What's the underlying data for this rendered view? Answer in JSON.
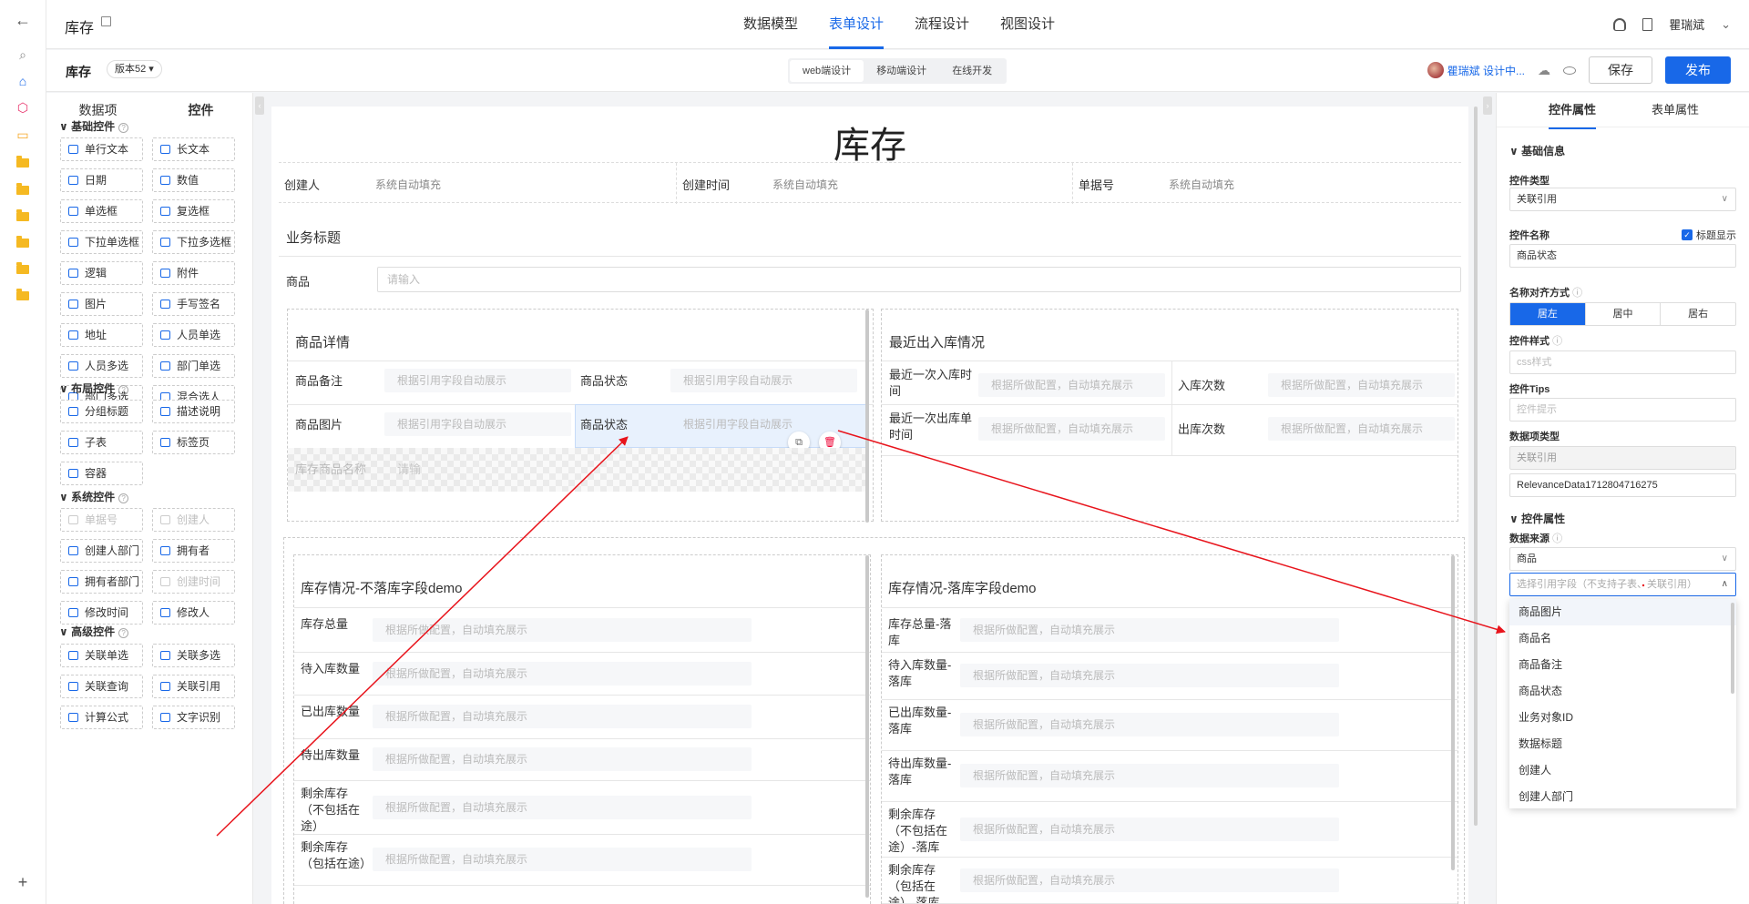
{
  "rail": {
    "icons": [
      "back-arrow-icon",
      "search-icon",
      "home-icon",
      "cube-icon",
      "message-icon",
      "folder-icon",
      "folder-icon",
      "folder-icon",
      "folder-icon",
      "folder-icon",
      "folder-icon",
      "plus-icon"
    ],
    "glyphs": {
      "back": "←",
      "search": "⌕",
      "home": "⌂",
      "cube": "⬡",
      "message": "▭",
      "plus": "+"
    },
    "accent_colors": {
      "home": "#1868e8",
      "cube": "#e8356d",
      "message": "#f5a623"
    }
  },
  "header": {
    "title": "库存",
    "nav": [
      "数据模型",
      "表单设计",
      "流程设计",
      "视图设计"
    ],
    "active_nav": "表单设计",
    "user": "瞿瑞斌",
    "user_suffix": "⌄"
  },
  "subbar": {
    "name": "库存",
    "version": "版本52 ▾",
    "segments": [
      "web端设计",
      "移动端设计",
      "在线开发"
    ],
    "active_segment": "web端设计",
    "designer": "瞿瑞斌 设计中...",
    "save": "保存",
    "publish": "发布"
  },
  "left_panel": {
    "tabs": [
      "数据项",
      "控件"
    ],
    "active_tab": "控件",
    "sections": {
      "basic": "基础控件",
      "layout": "布局控件",
      "system": "系统控件",
      "advanced": "高级控件"
    },
    "basic": [
      "单行文本",
      "长文本",
      "日期",
      "数值",
      "单选框",
      "复选框",
      "下拉单选框",
      "下拉多选框",
      "逻辑",
      "附件",
      "图片",
      "手写签名",
      "地址",
      "人员单选",
      "人员多选",
      "部门单选",
      "部门多选",
      "混合选人"
    ],
    "layout": [
      "分组标题",
      "描述说明",
      "子表",
      "标签页",
      "容器"
    ],
    "system": [
      "单据号",
      "创建人",
      "创建人部门",
      "拥有者",
      "拥有者部门",
      "创建时间",
      "修改时间",
      "修改人"
    ],
    "advanced": [
      "关联单选",
      "关联多选",
      "关联查询",
      "关联引用",
      "计算公式",
      "文字识别"
    ]
  },
  "canvas": {
    "form_title": "库存",
    "row1": [
      {
        "label": "创建人",
        "value": "系统自动填充"
      },
      {
        "label": "创建时间",
        "value": "系统自动填充"
      },
      {
        "label": "单据号",
        "value": "系统自动填充"
      }
    ],
    "biz_title": "业务标题",
    "goods_label": "商品",
    "goods_placeholder": "请输入",
    "detail": {
      "title": "商品详情",
      "fields": [
        {
          "label": "商品备注",
          "placeholder": "根据引用字段自动展示"
        },
        {
          "label": "商品状态",
          "placeholder": "根据引用字段自动展示"
        },
        {
          "label": "商品图片",
          "placeholder": "根据引用字段自动展示"
        },
        {
          "label": "商品状态",
          "placeholder": "根据引用字段自动展示"
        }
      ],
      "ghost_label": "库存商品名称",
      "ghost_value": "请输"
    },
    "recent": {
      "title": "最近出入库情况",
      "fields": [
        {
          "label": "最近一次入库时间",
          "placeholder": "根据所做配置，自动填充展示"
        },
        {
          "label": "入库次数",
          "placeholder": "根据所做配置，自动填充展示"
        },
        {
          "label": "最近一次出库单时间",
          "placeholder": "根据所做配置，自动填充展示"
        },
        {
          "label": "出库次数",
          "placeholder": "根据所做配置，自动填充展示"
        }
      ]
    },
    "stock_a": {
      "title": "库存情况-不落库字段demo",
      "fields": [
        {
          "label": "库存总量",
          "placeholder": "根据所做配置，自动填充展示"
        },
        {
          "label": "待入库数量",
          "placeholder": "根据所做配置，自动填充展示"
        },
        {
          "label": "已出库数量",
          "placeholder": "根据所做配置，自动填充展示"
        },
        {
          "label": "待出库数量",
          "placeholder": "根据所做配置，自动填充展示"
        },
        {
          "label": "剩余库存（不包括在途）",
          "placeholder": "根据所做配置，自动填充展示"
        },
        {
          "label": "剩余库存（包括在途）",
          "placeholder": "根据所做配置，自动填充展示"
        }
      ]
    },
    "stock_b": {
      "title": "库存情况-落库字段demo",
      "fields": [
        {
          "label": "库存总量-落库",
          "placeholder": "根据所做配置，自动填充展示"
        },
        {
          "label": "待入库数量-落库",
          "placeholder": "根据所做配置，自动填充展示"
        },
        {
          "label": "已出库数量-落库",
          "placeholder": "根据所做配置，自动填充展示"
        },
        {
          "label": "待出库数量-落库",
          "placeholder": "根据所做配置，自动填充展示"
        },
        {
          "label": "剩余库存（不包括在途）-落库",
          "placeholder": "根据所做配置，自动填充展示"
        },
        {
          "label": "剩余库存（包括在途）-落库",
          "placeholder": "根据所做配置，自动填充展示"
        }
      ]
    }
  },
  "right_panel": {
    "tabs": [
      "控件属性",
      "表单属性"
    ],
    "active_tab": "控件属性",
    "basic_section": "基础信息",
    "control_type_label": "控件类型",
    "control_type": "关联引用",
    "control_name_label": "控件名称",
    "control_name": "商品状态",
    "show_title": "标题显示",
    "align_label": "名称对齐方式",
    "align_options": [
      "居左",
      "居中",
      "居右"
    ],
    "align_selected": "居左",
    "style_label": "控件样式",
    "style_placeholder": "css样式",
    "tips_label": "控件Tips",
    "tips_placeholder": "控件提示",
    "datatype_label": "数据项类型",
    "datatype": "关联引用",
    "data_id": "RelevanceData1712804716275",
    "prop_section": "控件属性",
    "source_label": "数据来源",
    "source": "商品",
    "ref_placeholder": "选择引用字段（不支持子表、关联引用）",
    "options": [
      "商品图片",
      "商品名",
      "商品备注",
      "商品状态",
      "业务对象ID",
      "数据标题",
      "创建人",
      "创建人部门"
    ],
    "hover_option": "商品图片"
  },
  "colors": {
    "accent": "#1868e8",
    "annotation_arrow": "#e8141c",
    "selected_field_bg": "#e8f1fd"
  }
}
